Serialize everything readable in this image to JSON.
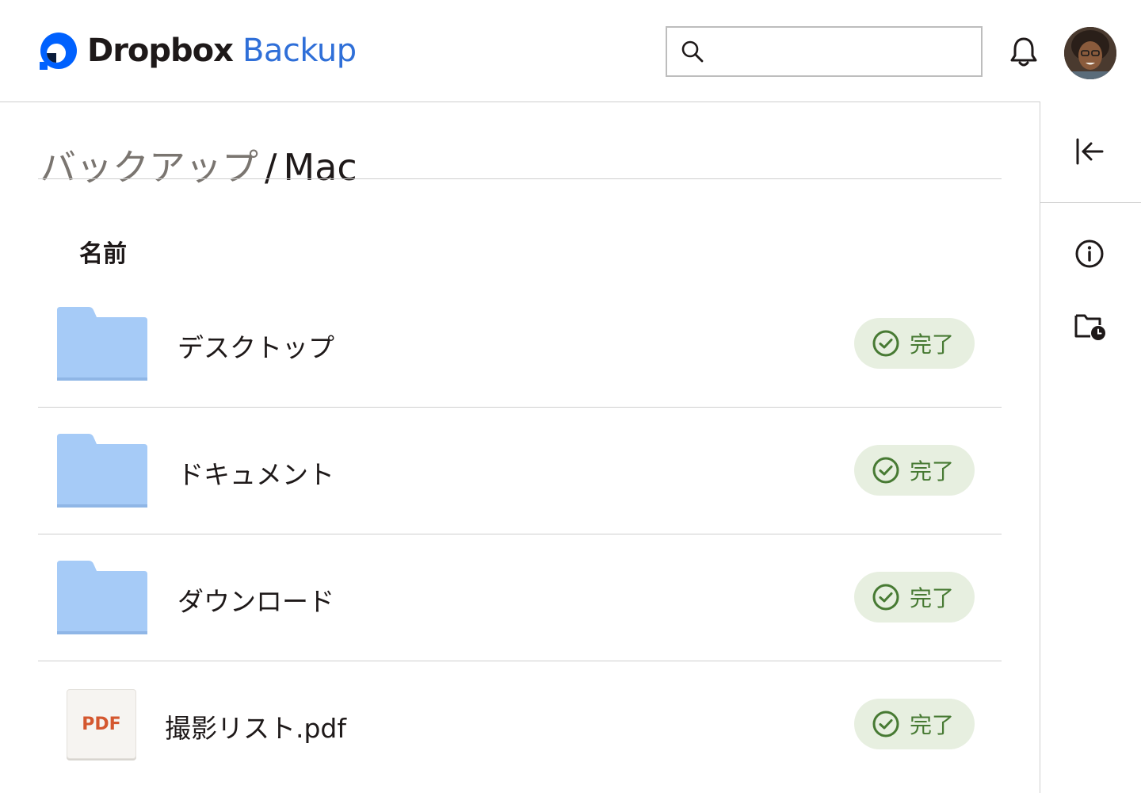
{
  "header": {
    "brand": "Dropbox",
    "product": "Backup",
    "search_placeholder": "",
    "brand_color": "#0061fe",
    "product_color": "#2f6fd8",
    "icons": [
      "search-icon",
      "bell-icon"
    ]
  },
  "breadcrumb": {
    "parent": "バックアップ",
    "separator": "/",
    "current": "Mac"
  },
  "table": {
    "column_name": "名前",
    "rows": [
      {
        "type": "folder",
        "name": "デスクトップ",
        "status": "完了"
      },
      {
        "type": "folder",
        "name": "ドキュメント",
        "status": "完了"
      },
      {
        "type": "folder",
        "name": "ダウンロード",
        "status": "完了"
      },
      {
        "type": "pdf",
        "name": "撮影リスト.pdf",
        "status": "完了",
        "file_badge": "PDF"
      }
    ]
  },
  "rail": {
    "icons": [
      "collapse-panel-icon",
      "info-icon",
      "folder-history-icon"
    ]
  },
  "colors": {
    "folder": "#a6cbf7",
    "status_bg": "#e7efe0",
    "status_text": "#477a33",
    "pdf_text": "#d4572f"
  }
}
